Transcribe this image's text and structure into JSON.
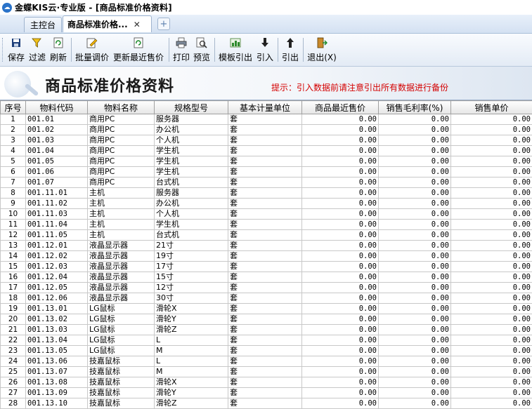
{
  "window": {
    "title": "金蝶KIS云·专业版 - [商品标准价格资料]"
  },
  "tabs": [
    {
      "label": "主控台"
    },
    {
      "label": "商品标准价格..."
    }
  ],
  "toolbar": {
    "save": "保存",
    "filter": "过滤",
    "refresh": "刷新",
    "batch_price": "批量调价",
    "update_price": "更新最近售价",
    "print": "打印",
    "preview": "预览",
    "template_export": "模板引出",
    "import": "引入",
    "export": "引出",
    "exit": "退出(X)"
  },
  "banner": {
    "title": "商品标准价格资料",
    "hint": "提示：引入数据前请注意引出所有数据进行备份"
  },
  "table": {
    "headers": [
      "序号",
      "物料代码",
      "物料名称",
      "规格型号",
      "基本计量单位",
      "商品最近售价",
      "销售毛利率(%)",
      "销售单价"
    ],
    "rows": [
      [
        "1",
        "001.01",
        "商用PC",
        "服务器",
        "套",
        "0.00",
        "0.00",
        "0.00"
      ],
      [
        "2",
        "001.02",
        "商用PC",
        "办公机",
        "套",
        "0.00",
        "0.00",
        "0.00"
      ],
      [
        "3",
        "001.03",
        "商用PC",
        "个人机",
        "套",
        "0.00",
        "0.00",
        "0.00"
      ],
      [
        "4",
        "001.04",
        "商用PC",
        "学生机",
        "套",
        "0.00",
        "0.00",
        "0.00"
      ],
      [
        "5",
        "001.05",
        "商用PC",
        "学生机",
        "套",
        "0.00",
        "0.00",
        "0.00"
      ],
      [
        "6",
        "001.06",
        "商用PC",
        "学生机",
        "套",
        "0.00",
        "0.00",
        "0.00"
      ],
      [
        "7",
        "001.07",
        "商用PC",
        "台式机",
        "套",
        "0.00",
        "0.00",
        "0.00"
      ],
      [
        "8",
        "001.11.01",
        "主机",
        "服务器",
        "套",
        "0.00",
        "0.00",
        "0.00"
      ],
      [
        "9",
        "001.11.02",
        "主机",
        "办公机",
        "套",
        "0.00",
        "0.00",
        "0.00"
      ],
      [
        "10",
        "001.11.03",
        "主机",
        "个人机",
        "套",
        "0.00",
        "0.00",
        "0.00"
      ],
      [
        "11",
        "001.11.04",
        "主机",
        "学生机",
        "套",
        "0.00",
        "0.00",
        "0.00"
      ],
      [
        "12",
        "001.11.05",
        "主机",
        "台式机",
        "套",
        "0.00",
        "0.00",
        "0.00"
      ],
      [
        "13",
        "001.12.01",
        "液晶显示器",
        "21寸",
        "套",
        "0.00",
        "0.00",
        "0.00"
      ],
      [
        "14",
        "001.12.02",
        "液晶显示器",
        "19寸",
        "套",
        "0.00",
        "0.00",
        "0.00"
      ],
      [
        "15",
        "001.12.03",
        "液晶显示器",
        "17寸",
        "套",
        "0.00",
        "0.00",
        "0.00"
      ],
      [
        "16",
        "001.12.04",
        "液晶显示器",
        "15寸",
        "套",
        "0.00",
        "0.00",
        "0.00"
      ],
      [
        "17",
        "001.12.05",
        "液晶显示器",
        "12寸",
        "套",
        "0.00",
        "0.00",
        "0.00"
      ],
      [
        "18",
        "001.12.06",
        "液晶显示器",
        "30寸",
        "套",
        "0.00",
        "0.00",
        "0.00"
      ],
      [
        "19",
        "001.13.01",
        "LG鼠标",
        "滑轮X",
        "套",
        "0.00",
        "0.00",
        "0.00"
      ],
      [
        "20",
        "001.13.02",
        "LG鼠标",
        "滑轮Y",
        "套",
        "0.00",
        "0.00",
        "0.00"
      ],
      [
        "21",
        "001.13.03",
        "LG鼠标",
        "滑轮Z",
        "套",
        "0.00",
        "0.00",
        "0.00"
      ],
      [
        "22",
        "001.13.04",
        "LG鼠标",
        "L",
        "套",
        "0.00",
        "0.00",
        "0.00"
      ],
      [
        "23",
        "001.13.05",
        "LG鼠标",
        "M",
        "套",
        "0.00",
        "0.00",
        "0.00"
      ],
      [
        "24",
        "001.13.06",
        "技嘉鼠标",
        "L",
        "套",
        "0.00",
        "0.00",
        "0.00"
      ],
      [
        "25",
        "001.13.07",
        "技嘉鼠标",
        "M",
        "套",
        "0.00",
        "0.00",
        "0.00"
      ],
      [
        "26",
        "001.13.08",
        "技嘉鼠标",
        "滑轮X",
        "套",
        "0.00",
        "0.00",
        "0.00"
      ],
      [
        "27",
        "001.13.09",
        "技嘉鼠标",
        "滑轮Y",
        "套",
        "0.00",
        "0.00",
        "0.00"
      ],
      [
        "28",
        "001.13.10",
        "技嘉鼠标",
        "滑轮Z",
        "套",
        "0.00",
        "0.00",
        "0.00"
      ]
    ]
  },
  "colors": {
    "hint": "#d40000",
    "accent": "#2a73c9"
  },
  "icons": {
    "save": "floppy-icon",
    "filter": "filter-icon",
    "refresh": "refresh-icon",
    "batch_price": "edit-icon",
    "update_price": "refresh-icon",
    "print": "printer-icon",
    "preview": "preview-icon",
    "template_export": "template-icon",
    "import": "import-icon",
    "export": "export-icon",
    "exit": "exit-icon"
  }
}
